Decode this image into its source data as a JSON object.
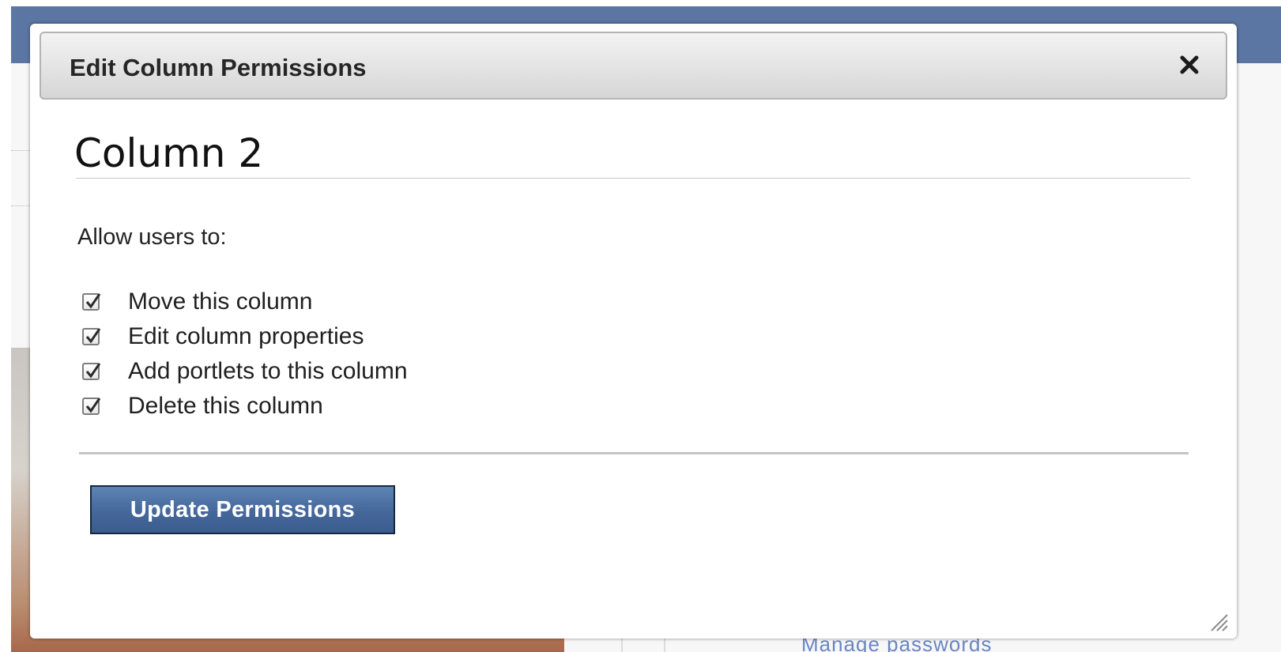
{
  "dialog": {
    "title": "Edit Column Permissions",
    "close_icon": "close-icon",
    "column_name": "Column 2",
    "lead_text": "Allow users to:",
    "permissions": [
      {
        "label": "Move this column",
        "checked": true
      },
      {
        "label": "Edit column properties",
        "checked": true
      },
      {
        "label": "Add portlets to this column",
        "checked": true
      },
      {
        "label": "Delete this column",
        "checked": true
      }
    ],
    "submit_label": "Update Permissions"
  },
  "background": {
    "link_text": "Manage passwords"
  },
  "colors": {
    "topbar": "#5b76a3",
    "button": "#45679a",
    "title_bar": "#e3e3e3"
  }
}
